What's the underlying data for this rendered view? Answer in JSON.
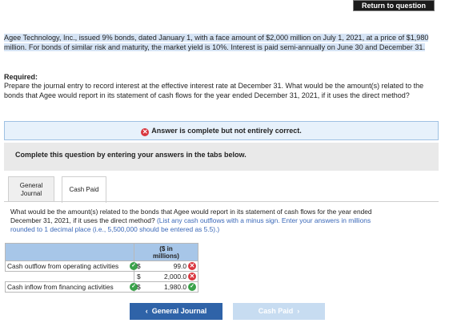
{
  "header": {
    "return_label": "Return to question"
  },
  "question": {
    "text": "Agee Technology, Inc., issued 9% bonds, dated January 1, with a face amount of $2,000 million on July 1, 2021, at a price of $1,980 million. For bonds of similar risk and maturity, the market yield is 10%. Interest is paid semi-annually on June 30 and December 31."
  },
  "required": {
    "heading": "Required:",
    "text": "Prepare the journal entry to record interest at the effective interest rate at December 31. What would be the amount(s) related to the bonds that Agee would report in its statement of cash flows for the year ended December 31, 2021, if it uses the direct method?"
  },
  "status": {
    "icon": "x-icon",
    "text": "Answer is complete but not entirely correct."
  },
  "instructions": {
    "text": "Complete this question by entering your answers in the tabs below."
  },
  "tabs": [
    {
      "label_line1": "General",
      "label_line2": "Journal"
    },
    {
      "label": "Cash Paid"
    }
  ],
  "prompt": {
    "main1": "What would be the amount(s) related to the bonds that Agee would report in its statement of cash flows for the year ended",
    "main2": "December 31, 2021, if it uses the direct method?",
    "hint2": "(List any cash outflows with a minus sign. Enter your answers in millions",
    "hint3": "rounded to 1 decimal place (i.e., 5,500,000 should be entered as 5.5).)"
  },
  "table": {
    "header_line1": "($ in",
    "header_line2": "millions)",
    "rows": [
      {
        "label": "Cash outflow from operating activities",
        "label_status": "correct",
        "currency": "$",
        "value": "99.0",
        "value_status": "incorrect"
      },
      {
        "label": "",
        "label_status": "",
        "currency": "$",
        "value": "2,000.0",
        "value_status": "incorrect"
      },
      {
        "label": "Cash inflow from financing activities",
        "label_status": "correct",
        "currency": "$",
        "value": "1,980.0",
        "value_status": "correct"
      }
    ]
  },
  "nav": {
    "prev_label": "General Journal",
    "next_label": "Cash Paid"
  },
  "colors": {
    "accent": "#2f63a8",
    "incorrect": "#d9363e",
    "correct": "#3aa24a",
    "header_fill": "#a7c6e8"
  }
}
